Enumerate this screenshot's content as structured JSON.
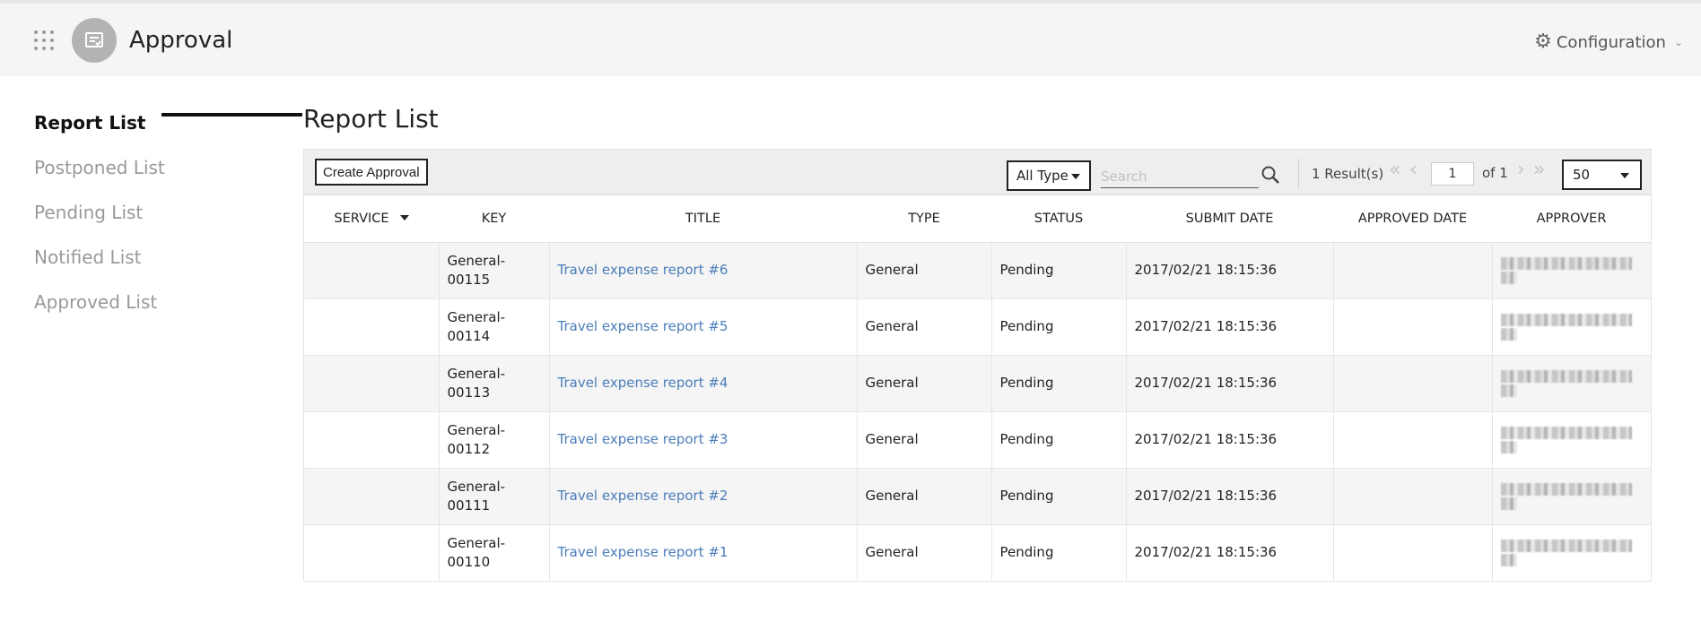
{
  "header": {
    "app_title": "Approval",
    "apps_icon": "grid-dots-icon",
    "logo_icon": "approval-doc-icon",
    "config_label": "Configuration"
  },
  "sidebar": {
    "items": [
      {
        "label": "Report List",
        "active": true
      },
      {
        "label": "Postponed List",
        "active": false
      },
      {
        "label": "Pending List",
        "active": false
      },
      {
        "label": "Notified List",
        "active": false
      },
      {
        "label": "Approved List",
        "active": false
      }
    ]
  },
  "main": {
    "title": "Report List",
    "toolbar": {
      "create_label": "Create Approval",
      "type_filter": "All Type",
      "search_placeholder": "Search",
      "results": "1 Result(s)",
      "page": "1",
      "of_pages": "of 1",
      "per_page": "50"
    },
    "table": {
      "columns": [
        "SERVICE",
        "KEY",
        "TITLE",
        "TYPE",
        "STATUS",
        "SUBMIT DATE",
        "APPROVED DATE",
        "APPROVER"
      ],
      "rows": [
        {
          "service": "",
          "key": "General-00115",
          "title": "Travel expense report #6",
          "type": "General",
          "status": "Pending",
          "submit_date": "2017/02/21 18:15:36",
          "approved_date": ""
        },
        {
          "service": "",
          "key": "General-00114",
          "title": "Travel expense report #5",
          "type": "General",
          "status": "Pending",
          "submit_date": "2017/02/21 18:15:36",
          "approved_date": ""
        },
        {
          "service": "",
          "key": "General-00113",
          "title": "Travel expense report #4",
          "type": "General",
          "status": "Pending",
          "submit_date": "2017/02/21 18:15:36",
          "approved_date": ""
        },
        {
          "service": "",
          "key": "General-00112",
          "title": "Travel expense report #3",
          "type": "General",
          "status": "Pending",
          "submit_date": "2017/02/21 18:15:36",
          "approved_date": ""
        },
        {
          "service": "",
          "key": "General-00111",
          "title": "Travel expense report #2",
          "type": "General",
          "status": "Pending",
          "submit_date": "2017/02/21 18:15:36",
          "approved_date": ""
        },
        {
          "service": "",
          "key": "General-00110",
          "title": "Travel expense report #1",
          "type": "General",
          "status": "Pending",
          "submit_date": "2017/02/21 18:15:36",
          "approved_date": ""
        }
      ]
    }
  },
  "colors": {
    "link": "#4a7db9",
    "header_bg": "#f5f5f5",
    "row_alt": "#f5f5f5"
  }
}
